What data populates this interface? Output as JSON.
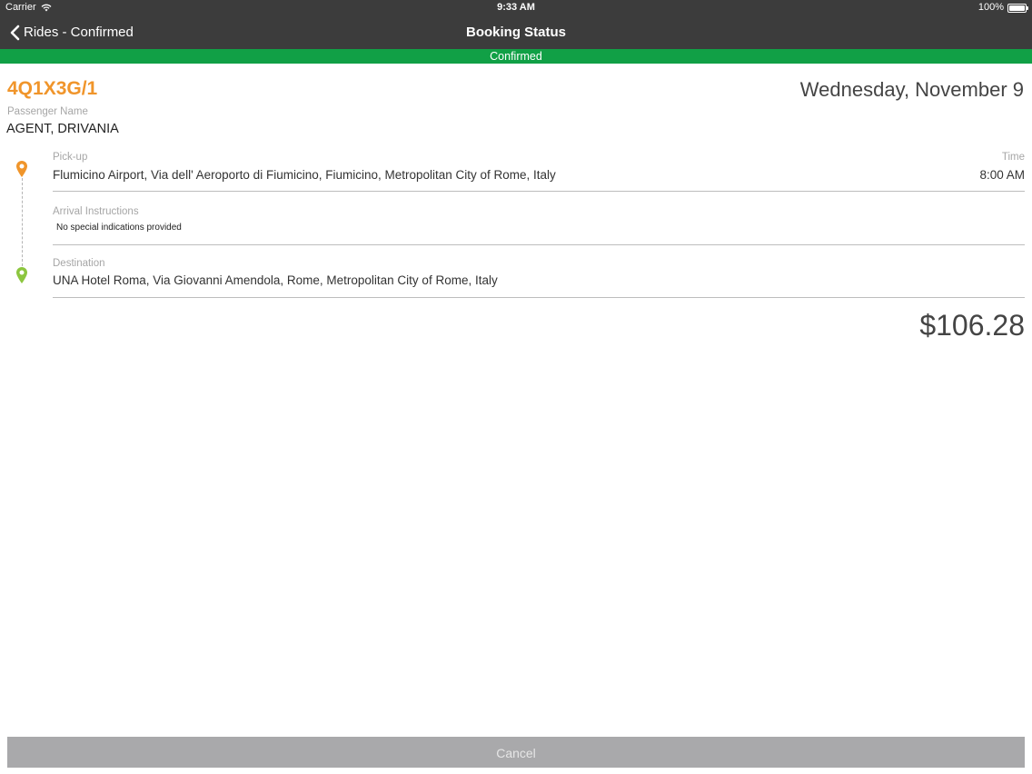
{
  "status_bar": {
    "carrier": "Carrier",
    "time": "9:33 AM",
    "battery": "100%",
    "battery_level": 1.0
  },
  "nav": {
    "back_label": "Rides - Confirmed",
    "title": "Booking Status"
  },
  "banner": {
    "text": "Confirmed",
    "color": "#11a046"
  },
  "booking": {
    "code": "4Q1X3G/1",
    "date": "Wednesday, November 9",
    "passenger_label": "Passenger Name",
    "passenger_name": "AGENT, DRIVANIA"
  },
  "pickup": {
    "label": "Pick-up",
    "address": "Flumicino Airport, Via dell' Aeroporto di Fiumicino, Fiumicino, Metropolitan City of Rome, Italy",
    "time_label": "Time",
    "time": "8:00 AM",
    "icon": "map-pin-icon",
    "icon_color": "#f0952b"
  },
  "arrival": {
    "label": "Arrival Instructions",
    "text": "No special indications provided"
  },
  "destination": {
    "label": "Destination",
    "address": "UNA Hotel Roma, Via Giovanni Amendola, Rome, Metropolitan City of Rome, Italy",
    "icon": "map-pin-icon",
    "icon_color": "#8cc63f"
  },
  "price": "$106.28",
  "footer": {
    "cancel_label": "Cancel"
  },
  "colors": {
    "accent_orange": "#f0952b",
    "header_bg": "#3c3c3c",
    "cancel_bg": "#a9a9ab"
  }
}
